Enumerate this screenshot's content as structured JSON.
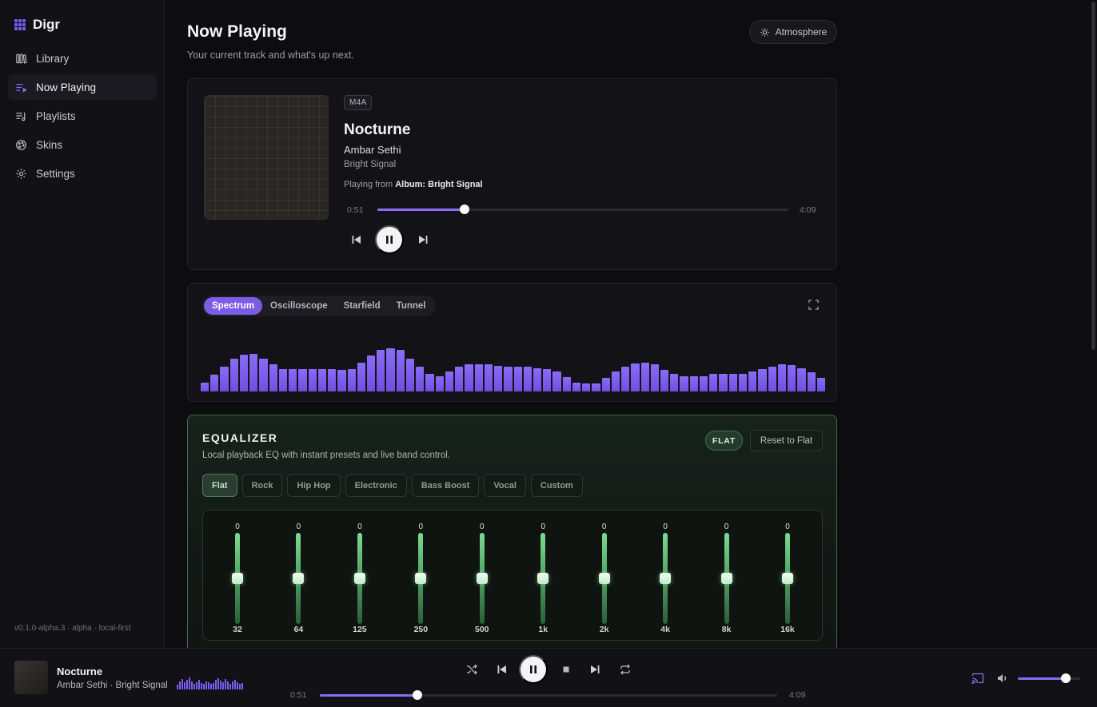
{
  "app": {
    "name": "Digr",
    "version": "v0.1.0-alpha.3 · alpha · local-first"
  },
  "sidebar": {
    "items": [
      {
        "label": "Library",
        "icon": "library-icon",
        "active": false
      },
      {
        "label": "Now Playing",
        "icon": "now-playing-icon",
        "active": true
      },
      {
        "label": "Playlists",
        "icon": "playlists-icon",
        "active": false
      },
      {
        "label": "Skins",
        "icon": "skins-icon",
        "active": false
      },
      {
        "label": "Settings",
        "icon": "gear-icon",
        "active": false
      }
    ]
  },
  "header": {
    "title": "Now Playing",
    "subtitle": "Your current track and what's up next.",
    "atmosphere_label": "Atmosphere"
  },
  "now_playing": {
    "format": "M4A",
    "title": "Nocturne",
    "artist": "Ambar Sethi",
    "album": "Bright Signal",
    "playing_from_prefix": "Playing from",
    "playing_from_source": "Album: Bright Signal",
    "time_current": "0:51",
    "time_total": "4:09",
    "progress": 0.213
  },
  "visualizer": {
    "tabs": [
      "Spectrum",
      "Oscilloscope",
      "Starfield",
      "Tunnel"
    ],
    "active_tab": "Spectrum",
    "accent": "#7c5ce6",
    "levels": [
      0.15,
      0.28,
      0.42,
      0.55,
      0.62,
      0.63,
      0.55,
      0.45,
      0.38,
      0.37,
      0.37,
      0.38,
      0.38,
      0.37,
      0.36,
      0.38,
      0.48,
      0.6,
      0.7,
      0.72,
      0.7,
      0.55,
      0.42,
      0.3,
      0.26,
      0.34,
      0.42,
      0.45,
      0.46,
      0.45,
      0.43,
      0.41,
      0.41,
      0.41,
      0.39,
      0.38,
      0.33,
      0.24,
      0.15,
      0.13,
      0.14,
      0.23,
      0.33,
      0.42,
      0.47,
      0.48,
      0.45,
      0.36,
      0.3,
      0.25,
      0.25,
      0.26,
      0.29,
      0.3,
      0.3,
      0.3,
      0.33,
      0.38,
      0.42,
      0.45,
      0.44,
      0.39,
      0.32,
      0.23
    ]
  },
  "equalizer": {
    "title": "EQUALIZER",
    "subtitle": "Local playback EQ with instant presets and live band control.",
    "preset_badge": "FLAT",
    "reset_label": "Reset to Flat",
    "presets": [
      "Flat",
      "Rock",
      "Hip Hop",
      "Electronic",
      "Bass Boost",
      "Vocal",
      "Custom"
    ],
    "active_preset": "Flat",
    "bands": [
      {
        "freq": "32",
        "gain": "0"
      },
      {
        "freq": "64",
        "gain": "0"
      },
      {
        "freq": "125",
        "gain": "0"
      },
      {
        "freq": "250",
        "gain": "0"
      },
      {
        "freq": "500",
        "gain": "0"
      },
      {
        "freq": "1k",
        "gain": "0"
      },
      {
        "freq": "2k",
        "gain": "0"
      },
      {
        "freq": "4k",
        "gain": "0"
      },
      {
        "freq": "8k",
        "gain": "0"
      },
      {
        "freq": "16k",
        "gain": "0"
      }
    ]
  },
  "player": {
    "title": "Nocturne",
    "subtitle": "Ambar Sethi · Bright Signal",
    "time_current": "0:51",
    "time_total": "4:09",
    "progress": 0.213,
    "volume": 0.77
  }
}
